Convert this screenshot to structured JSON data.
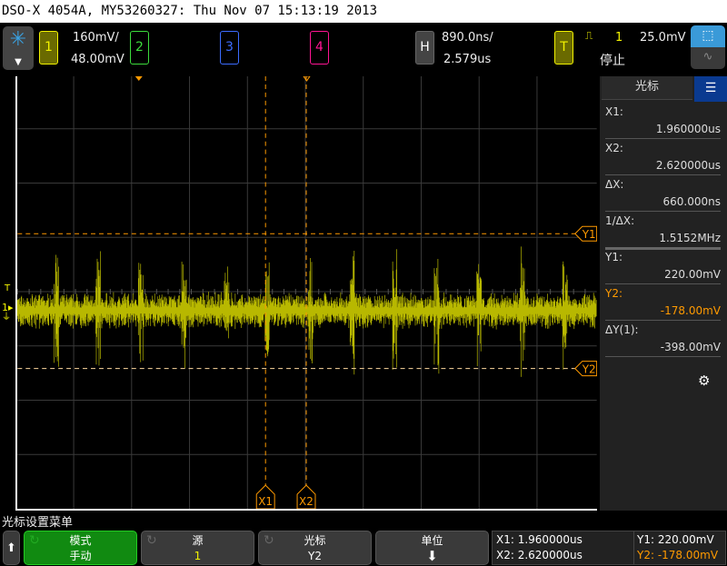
{
  "title": "DSO-X 4054A, MY53260327: Thu Nov 07 15:13:19 2013",
  "channel1": {
    "label": "1",
    "scale": "160mV/",
    "offset": "48.00mV",
    "color": "#f2f200"
  },
  "channel2": {
    "label": "2",
    "color": "#3cdc3c"
  },
  "channel3": {
    "label": "3",
    "color": "#3c6cff"
  },
  "channel4": {
    "label": "4",
    "color": "#ff1493"
  },
  "horizontal": {
    "label": "H",
    "scale": "890.0ns/",
    "delay": "2.579us"
  },
  "trigger": {
    "label": "T",
    "source": "1",
    "level": "25.0mV",
    "status": "停止"
  },
  "cursor_colors": {
    "cursor": "#ff9a00"
  },
  "plot": {
    "x1_label": "X1",
    "x2_label": "X2",
    "y1_label": "Y1",
    "y2_label": "Y2"
  },
  "panel": {
    "title": "光标",
    "items": [
      {
        "label": "X1:",
        "value": "1.960000us"
      },
      {
        "label": "X2:",
        "value": "2.620000us"
      },
      {
        "label": "ΔX:",
        "value": "660.000ns"
      },
      {
        "label": "1/ΔX:",
        "value": "1.5152MHz"
      },
      {
        "label": "Y1:",
        "value": "220.00mV"
      },
      {
        "label": "Y2:",
        "value": "-178.00mV"
      },
      {
        "label": "ΔY(1):",
        "value": "-398.00mV"
      }
    ]
  },
  "menu": {
    "title": "光标设置菜单",
    "mode": {
      "label": "模式",
      "value": "手动"
    },
    "source": {
      "label": "源",
      "value": "1"
    },
    "cursor": {
      "label": "光标",
      "value": "Y2"
    },
    "units": {
      "label": "单位"
    },
    "readout": {
      "x1": "X1: 1.960000us",
      "x2": "X2: 2.620000us",
      "y1": "Y1: 220.00mV",
      "y2": "Y2: -178.00mV"
    }
  }
}
